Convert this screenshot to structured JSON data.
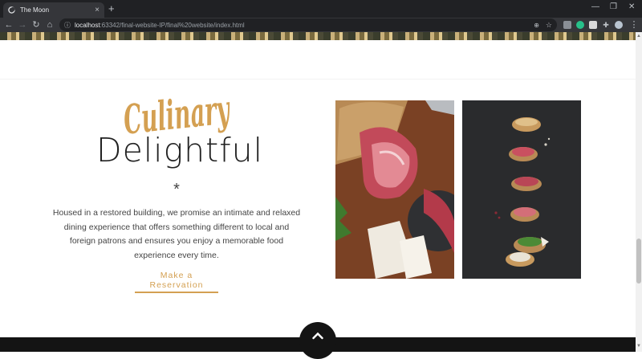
{
  "browser": {
    "tab_title": "The Moon",
    "tab_close": "×",
    "new_tab": "+",
    "url_host": "localhost",
    "url_path": ":63342/final-website-IP/final%20website/index.html",
    "window_min": "—",
    "window_restore": "❐",
    "window_close": "✕"
  },
  "section": {
    "script_word": "Culinary",
    "headline": "Delightful",
    "ornament": "*",
    "description": "Housed in a restored building, we promise an intimate and relaxed dining experience that offers something different to local and foreign patrons and ensures you enjoy a memorable food experience every time.",
    "cta_label": "Make a Reservation"
  },
  "images": [
    {
      "alt": "Prosciutto, bread and cheese on a wooden board"
    },
    {
      "alt": "Bruschetta with cured meats on dark slate"
    }
  ],
  "colors": {
    "accent": "#d4a052",
    "text": "#444444",
    "headline": "#222222",
    "footer": "#141414"
  }
}
